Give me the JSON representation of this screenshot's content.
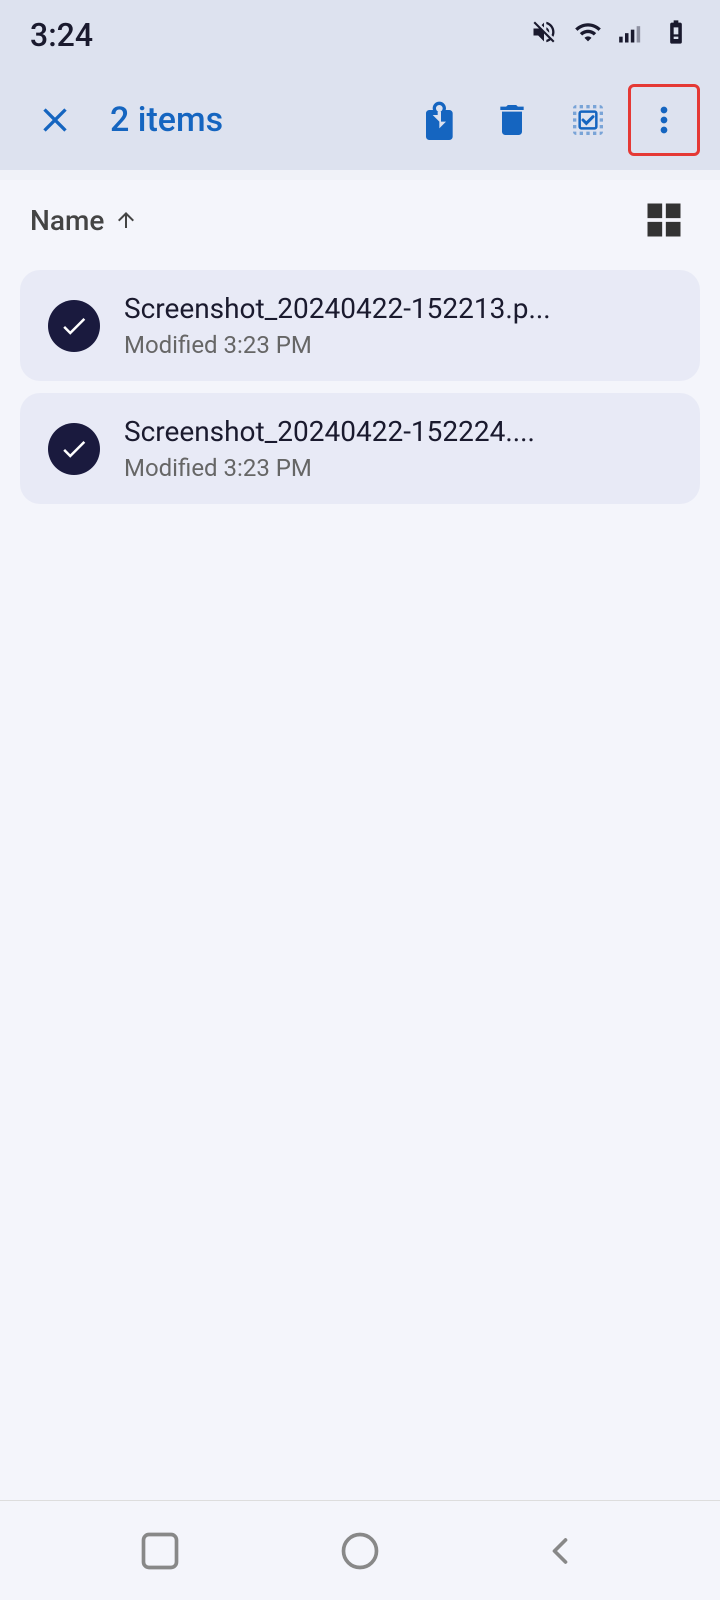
{
  "status_bar": {
    "time": "3:24",
    "icons": {
      "mute": "🔕",
      "wifi": "wifi",
      "signal": "signal",
      "battery": "battery"
    }
  },
  "toolbar": {
    "close_label": "×",
    "items_count": "2 items",
    "move_label": "Move",
    "delete_label": "Delete",
    "select_all_label": "Select All",
    "more_label": "More options"
  },
  "sort_bar": {
    "sort_label": "Name",
    "sort_direction": "ascending",
    "view_mode": "grid"
  },
  "files": [
    {
      "name": "Screenshot_20240422-152213.p...",
      "modified": "Modified 3:23 PM",
      "selected": true
    },
    {
      "name": "Screenshot_20240422-152224....",
      "modified": "Modified 3:23 PM",
      "selected": true
    }
  ],
  "bottom_nav": {
    "recent_label": "Recent",
    "home_label": "Home",
    "back_label": "Back"
  }
}
